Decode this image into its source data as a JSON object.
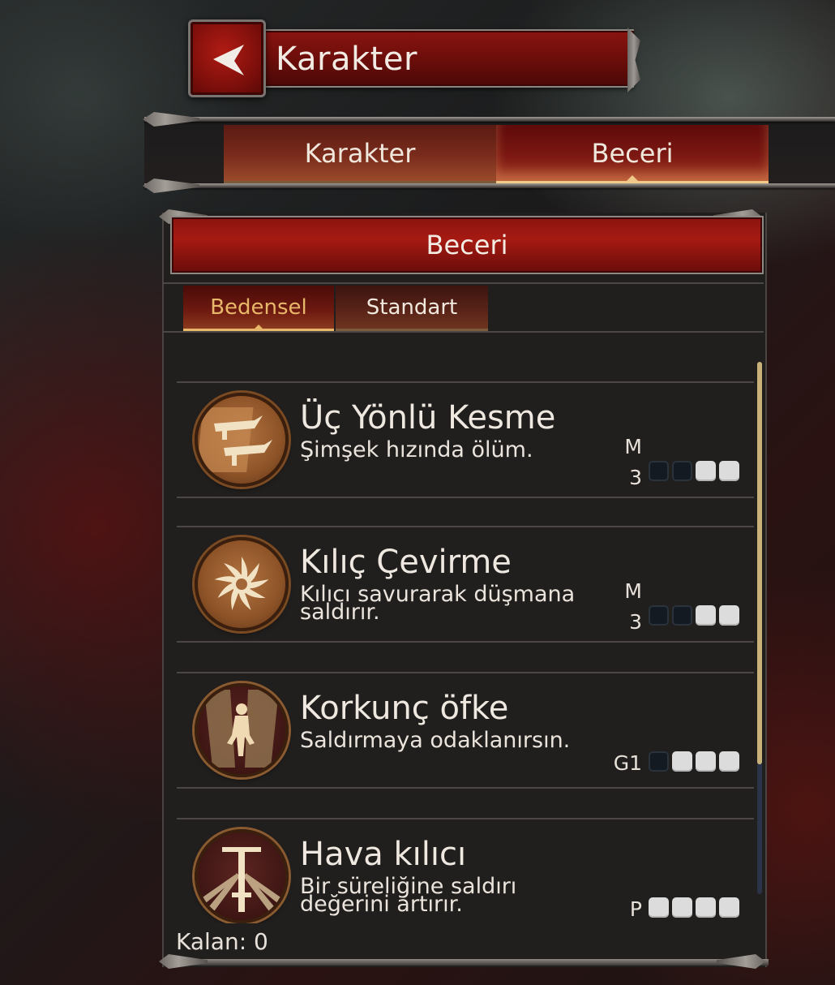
{
  "header": {
    "title": "Karakter",
    "back_icon": "back-arrow-icon"
  },
  "main_tabs": [
    {
      "label": "Karakter",
      "active": false
    },
    {
      "label": "Beceri",
      "active": true
    }
  ],
  "panel": {
    "title": "Beceri"
  },
  "sub_tabs": [
    {
      "label": "Bedensel",
      "active": true
    },
    {
      "label": "Standart",
      "active": false
    }
  ],
  "skills": [
    {
      "name": "Üç Yönlü Kesme",
      "description": "Şimşek hızında ölüm.",
      "cost": "M 3",
      "level": 2,
      "max_level": 4,
      "icon": "triple-dagger-icon"
    },
    {
      "name": "Kılıç Çevirme",
      "description": "Kılıcı savurarak düşmana saldırır.",
      "cost": "M 3",
      "level": 2,
      "max_level": 4,
      "icon": "spinning-blade-icon"
    },
    {
      "name": "Korkunç öfke",
      "description": "Saldırmaya odaklanırsın.",
      "cost": "G1",
      "level": 1,
      "max_level": 4,
      "icon": "rage-warrior-icon"
    },
    {
      "name": "Hava kılıcı",
      "description": "Bir süreliğine saldırı değerini artırır.",
      "cost": "P",
      "level": 0,
      "max_level": 4,
      "icon": "air-sword-icon"
    }
  ],
  "footer": {
    "remaining": "Kalan: 0"
  },
  "colors": {
    "accent_red": "#8a1410",
    "gold": "#e8b86a",
    "panel_bg": "#211f1e"
  }
}
